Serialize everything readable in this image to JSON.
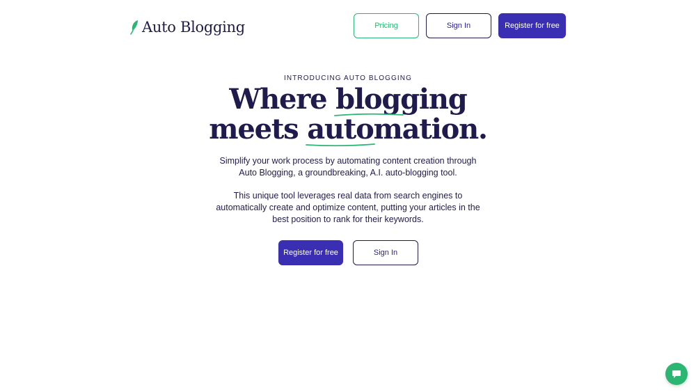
{
  "header": {
    "logo_text": "Auto Blogging",
    "pricing_label": "Pricing",
    "signin_label": "Sign In",
    "register_label": "Register for free"
  },
  "hero": {
    "eyebrow": "INTRODUCING AUTO BLOGGING",
    "headline_line1_a": "Where ",
    "headline_line1_b": "blogging",
    "headline_line2_a": "meets ",
    "headline_line2_b": "automation",
    "headline_line2_c": ".",
    "paragraph1_line1": "Simplify your work process by automating content creation through",
    "paragraph1_line2": "Auto Blogging, a groundbreaking, A.I. auto-blogging tool.",
    "paragraph2_line1": "This unique tool leverages real data from search engines to",
    "paragraph2_line2": "automatically create and optimize content, putting your articles in the",
    "paragraph2_line3": "best position to rank for their keywords.",
    "register_label": "Register for free",
    "signin_label": "Sign In"
  },
  "colors": {
    "brand_navy": "#1f1b4d",
    "primary_button": "#3a2fb3",
    "accent_green": "#2bb673",
    "background": "#ffffff"
  },
  "icons": {
    "logo": "feather-icon",
    "chat": "chat-bubble-icon"
  }
}
